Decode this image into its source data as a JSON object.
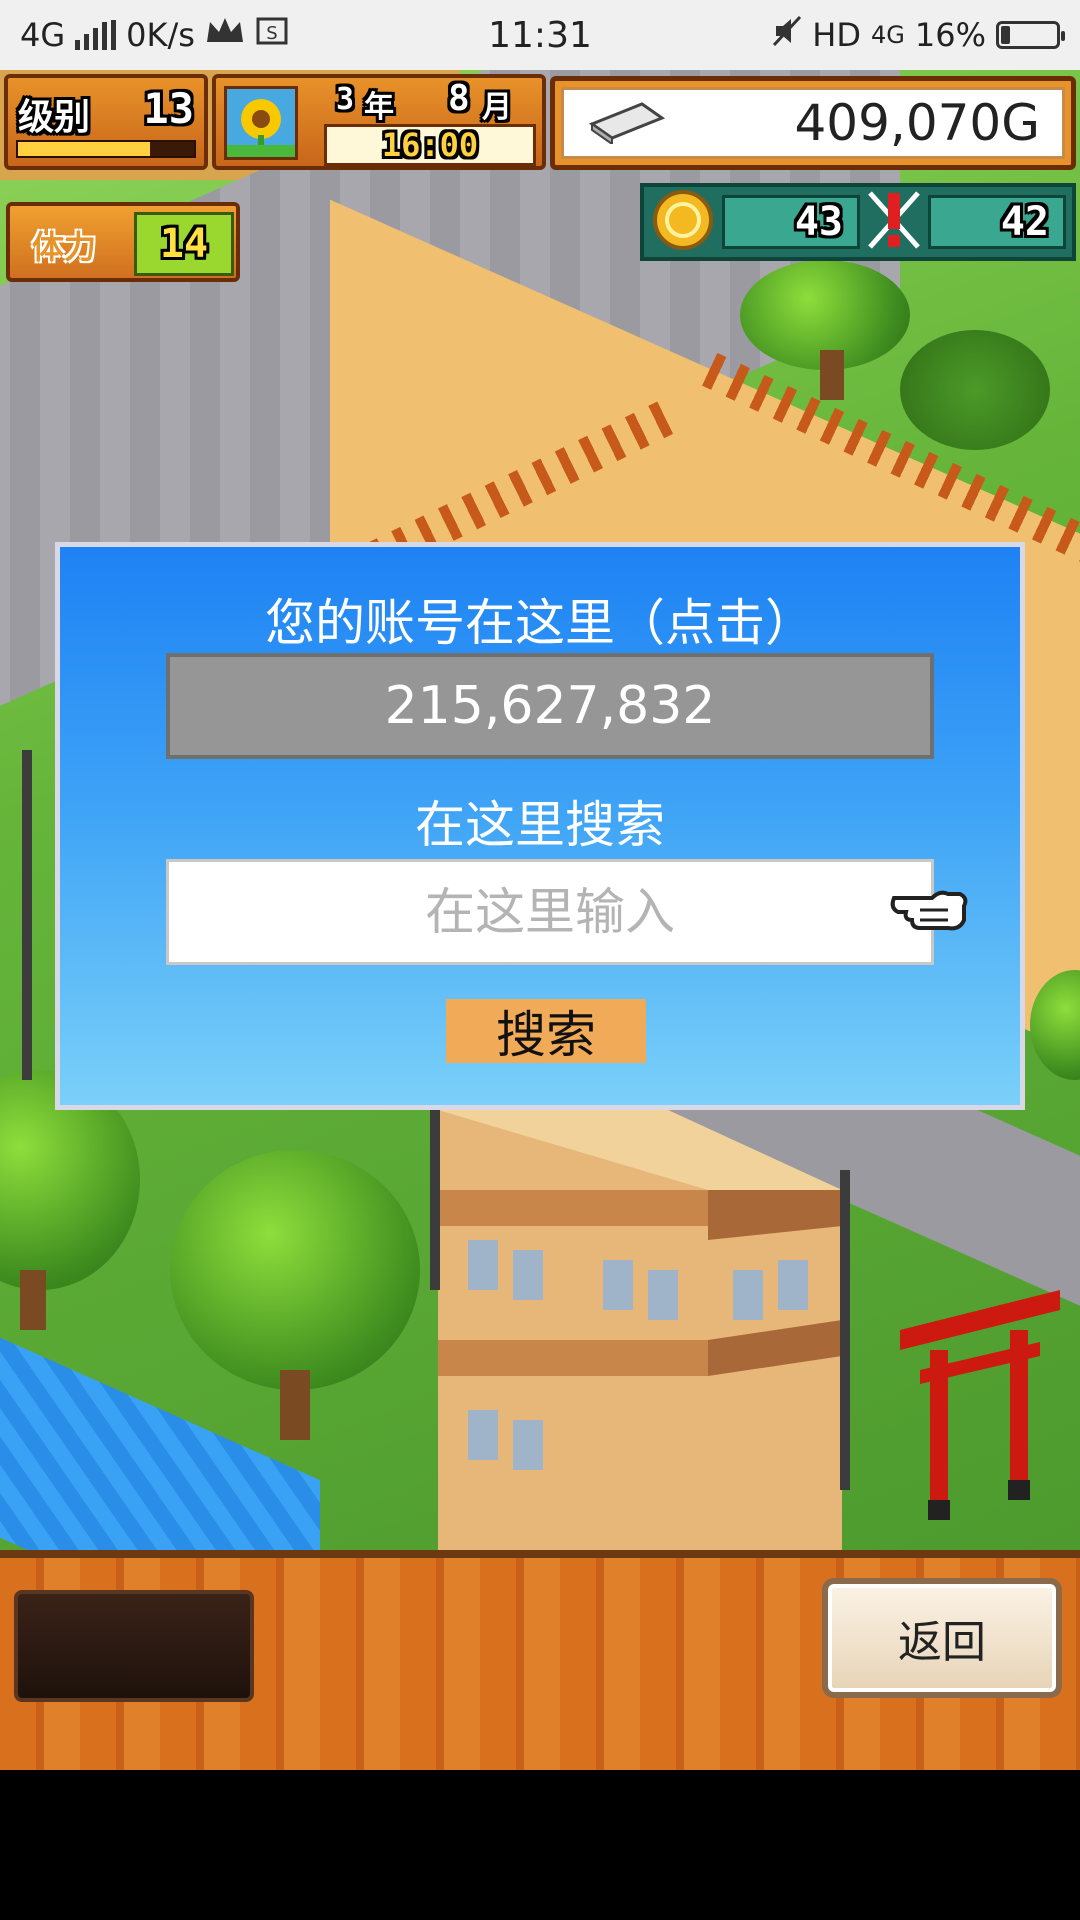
{
  "status_bar": {
    "network": "4G",
    "speed": "0K/s",
    "time": "11:31",
    "hd": "HD",
    "network_right": "4G",
    "battery": "16%",
    "battery_level": 0.16
  },
  "hud": {
    "level_label": "级别",
    "level_value": "13",
    "level_progress": 0.75,
    "date_year": "3",
    "date_year_unit": "年",
    "date_month": "8",
    "date_month_unit": "月",
    "game_time": "16:00",
    "money": "409,070G",
    "stamina_label": "体力",
    "stamina_value": "14",
    "medal_count": "43",
    "alert_count": "42"
  },
  "dialog": {
    "account_label": "您的账号在这里（点击）",
    "account_number": "215,627,832",
    "search_label": "在这里搜索",
    "search_placeholder": "在这里输入",
    "search_value": "",
    "search_button": "搜索"
  },
  "bottom_bar": {
    "back_button": "返回"
  },
  "colors": {
    "dialog_top": "#1e82f4",
    "dialog_bottom": "#7ad0f8",
    "search_button": "#f0aa58",
    "hud_orange": "#e8922a",
    "gauge_teal": "#3aa890"
  },
  "icons": [
    "signal-icon",
    "crown-icon",
    "screenshot-icon",
    "mute-icon",
    "battery-icon",
    "sunflower-icon",
    "money-bar-icon",
    "coin-medal-icon",
    "alert-icon",
    "pointing-hand-icon"
  ]
}
